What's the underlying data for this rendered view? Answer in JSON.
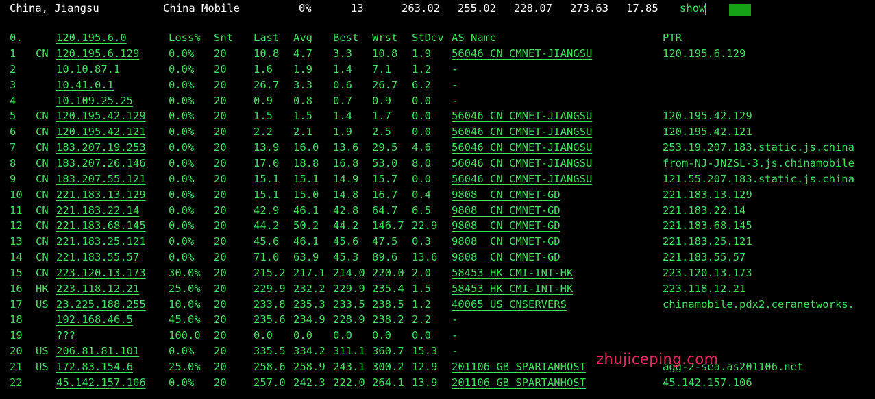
{
  "status_bar": {
    "location": "China, Jiangsu",
    "isp": "China Mobile",
    "loss": "0%",
    "count": "13",
    "v1": "263.02",
    "v2": "255.02",
    "v3": "228.07",
    "v4": "273.63",
    "v5": "17.85",
    "show": "show"
  },
  "table": {
    "headers": {
      "idx": "0.",
      "host": "120.195.6.0",
      "loss": "Loss%",
      "snt": "Snt",
      "last": "Last",
      "avg": "Avg",
      "best": "Best",
      "wrst": "Wrst",
      "stdev": "StDev",
      "as": "AS Name",
      "ptr": "PTR"
    },
    "rows": [
      {
        "idx": "1",
        "cc": "CN",
        "host": "120.195.6.129",
        "loss": "0.0%",
        "snt": "20",
        "last": "10.8",
        "avg": "4.7",
        "best": "3.3",
        "wrst": "10.8",
        "stdev": "1.9",
        "as": "56046 CN CMNET-JIANGSU",
        "ptr": "120.195.6.129"
      },
      {
        "idx": "2",
        "cc": "",
        "host": "10.10.87.1",
        "loss": "0.0%",
        "snt": "20",
        "last": "1.6",
        "avg": "1.9",
        "best": "1.4",
        "wrst": "7.1",
        "stdev": "1.2",
        "as": "-",
        "ptr": ""
      },
      {
        "idx": "3",
        "cc": "",
        "host": "10.41.0.1",
        "loss": "0.0%",
        "snt": "20",
        "last": "26.7",
        "avg": "3.3",
        "best": "0.6",
        "wrst": "26.7",
        "stdev": "6.2",
        "as": "-",
        "ptr": ""
      },
      {
        "idx": "4",
        "cc": "",
        "host": "10.109.25.25",
        "loss": "0.0%",
        "snt": "20",
        "last": "0.9",
        "avg": "0.8",
        "best": "0.7",
        "wrst": "0.9",
        "stdev": "0.0",
        "as": "-",
        "ptr": ""
      },
      {
        "idx": "5",
        "cc": "CN",
        "host": "120.195.42.129",
        "loss": "0.0%",
        "snt": "20",
        "last": "1.5",
        "avg": "1.5",
        "best": "1.4",
        "wrst": "1.7",
        "stdev": "0.0",
        "as": "56046 CN CMNET-JIANGSU",
        "ptr": "120.195.42.129"
      },
      {
        "idx": "6",
        "cc": "CN",
        "host": "120.195.42.121",
        "loss": "0.0%",
        "snt": "20",
        "last": "2.2",
        "avg": "2.1",
        "best": "1.9",
        "wrst": "2.5",
        "stdev": "0.0",
        "as": "56046 CN CMNET-JIANGSU",
        "ptr": "120.195.42.121"
      },
      {
        "idx": "7",
        "cc": "CN",
        "host": "183.207.19.253",
        "loss": "0.0%",
        "snt": "20",
        "last": "13.9",
        "avg": "16.0",
        "best": "13.6",
        "wrst": "29.5",
        "stdev": "4.6",
        "as": "56046 CN CMNET-JIANGSU",
        "ptr": "253.19.207.183.static.js.china"
      },
      {
        "idx": "8",
        "cc": "CN",
        "host": "183.207.26.146",
        "loss": "0.0%",
        "snt": "20",
        "last": "17.0",
        "avg": "18.8",
        "best": "16.8",
        "wrst": "53.0",
        "stdev": "8.0",
        "as": "56046 CN CMNET-JIANGSU",
        "ptr": "from-NJ-JNZSL-3.js.chinamobile"
      },
      {
        "idx": "9",
        "cc": "CN",
        "host": "183.207.55.121",
        "loss": "0.0%",
        "snt": "20",
        "last": "15.1",
        "avg": "15.1",
        "best": "14.9",
        "wrst": "15.7",
        "stdev": "0.0",
        "as": "56046 CN CMNET-JIANGSU",
        "ptr": "121.55.207.183.static.js.china"
      },
      {
        "idx": "10",
        "cc": "CN",
        "host": "221.183.13.129",
        "loss": "0.0%",
        "snt": "20",
        "last": "15.1",
        "avg": "15.0",
        "best": "14.8",
        "wrst": "16.7",
        "stdev": "0.4",
        "as": "9808  CN CMNET-GD",
        "ptr": "221.183.13.129"
      },
      {
        "idx": "11",
        "cc": "CN",
        "host": "221.183.22.14",
        "loss": "0.0%",
        "snt": "20",
        "last": "42.9",
        "avg": "46.1",
        "best": "42.8",
        "wrst": "64.7",
        "stdev": "6.5",
        "as": "9808  CN CMNET-GD",
        "ptr": "221.183.22.14"
      },
      {
        "idx": "12",
        "cc": "CN",
        "host": "221.183.68.145",
        "loss": "0.0%",
        "snt": "20",
        "last": "44.2",
        "avg": "50.2",
        "best": "44.2",
        "wrst": "146.7",
        "stdev": "22.9",
        "as": "9808  CN CMNET-GD",
        "ptr": "221.183.68.145"
      },
      {
        "idx": "13",
        "cc": "CN",
        "host": "221.183.25.121",
        "loss": "0.0%",
        "snt": "20",
        "last": "45.6",
        "avg": "46.1",
        "best": "45.6",
        "wrst": "47.5",
        "stdev": "0.3",
        "as": "9808  CN CMNET-GD",
        "ptr": "221.183.25.121"
      },
      {
        "idx": "14",
        "cc": "CN",
        "host": "221.183.55.57",
        "loss": "0.0%",
        "snt": "20",
        "last": "71.0",
        "avg": "63.9",
        "best": "45.3",
        "wrst": "89.6",
        "stdev": "13.6",
        "as": "9808  CN CMNET-GD",
        "ptr": "221.183.55.57"
      },
      {
        "idx": "15",
        "cc": "CN",
        "host": "223.120.13.173",
        "loss": "30.0%",
        "snt": "20",
        "last": "215.2",
        "avg": "217.1",
        "best": "214.0",
        "wrst": "220.0",
        "stdev": "2.0",
        "as": "58453 HK CMI-INT-HK",
        "ptr": "223.120.13.173"
      },
      {
        "idx": "16",
        "cc": "HK",
        "host": "223.118.12.21",
        "loss": "25.0%",
        "snt": "20",
        "last": "229.9",
        "avg": "232.2",
        "best": "229.9",
        "wrst": "235.4",
        "stdev": "1.5",
        "as": "58453 HK CMI-INT-HK",
        "ptr": "223.118.12.21"
      },
      {
        "idx": "17",
        "cc": "US",
        "host": "23.225.188.255",
        "loss": "10.0%",
        "snt": "20",
        "last": "233.8",
        "avg": "235.3",
        "best": "233.5",
        "wrst": "238.5",
        "stdev": "1.2",
        "as": "40065 US CNSERVERS",
        "ptr": "chinamobile.pdx2.ceranetworks."
      },
      {
        "idx": "18",
        "cc": "",
        "host": "192.168.46.5",
        "loss": "45.0%",
        "snt": "20",
        "last": "235.6",
        "avg": "234.9",
        "best": "228.9",
        "wrst": "238.2",
        "stdev": "2.2",
        "as": "-",
        "ptr": ""
      },
      {
        "idx": "19",
        "cc": "",
        "host": "???",
        "loss": "100.0",
        "snt": "20",
        "last": "0.0",
        "avg": "0.0",
        "best": "0.0",
        "wrst": "0.0",
        "stdev": "0.0",
        "as": "-",
        "ptr": ""
      },
      {
        "idx": "20",
        "cc": "US",
        "host": "206.81.81.101",
        "loss": "0.0%",
        "snt": "20",
        "last": "335.5",
        "avg": "334.2",
        "best": "311.1",
        "wrst": "360.7",
        "stdev": "15.3",
        "as": "-",
        "ptr": ""
      },
      {
        "idx": "21",
        "cc": "US",
        "host": "172.83.154.6",
        "loss": "25.0%",
        "snt": "20",
        "last": "258.6",
        "avg": "258.9",
        "best": "243.1",
        "wrst": "300.2",
        "stdev": "12.9",
        "as": "201106 GB SPARTANHOST",
        "ptr": "agg-2-sea.as201106.net"
      },
      {
        "idx": "22",
        "cc": "",
        "host": "45.142.157.106",
        "loss": "0.0%",
        "snt": "20",
        "last": "257.0",
        "avg": "242.3",
        "best": "222.0",
        "wrst": "264.1",
        "stdev": "13.9",
        "as": "201106 GB SPARTANHOST",
        "ptr": "45.142.157.106"
      }
    ]
  },
  "watermark": "zhujiceping.com",
  "colors": {
    "background": "#000000",
    "text": "#3ee05a",
    "status_text": "#ffffff",
    "watermark": "#ff2a6a"
  }
}
